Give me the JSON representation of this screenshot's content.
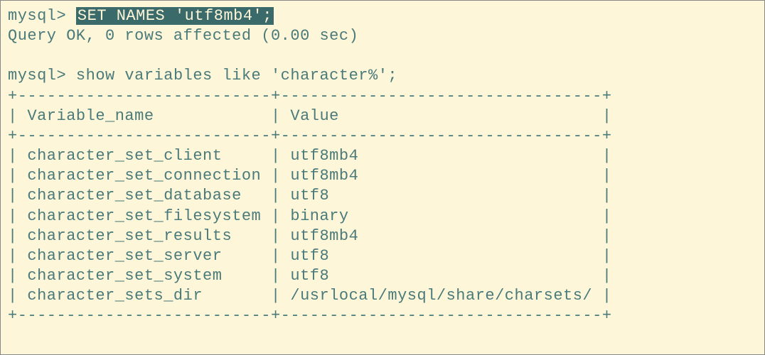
{
  "prompt": "mysql>",
  "commands": {
    "set_names": "SET NAMES 'utf8mb4';",
    "response": "Query OK, 0 rows affected (0.00 sec)",
    "show_vars": "show variables like 'character%';"
  },
  "table": {
    "col1_header": "Variable_name",
    "col2_header": "Value",
    "col1_width": 26,
    "col2_width": 33,
    "rows": [
      {
        "name": "character_set_client",
        "value": "utf8mb4"
      },
      {
        "name": "character_set_connection",
        "value": "utf8mb4"
      },
      {
        "name": "character_set_database",
        "value": "utf8"
      },
      {
        "name": "character_set_filesystem",
        "value": "binary"
      },
      {
        "name": "character_set_results",
        "value": "utf8mb4"
      },
      {
        "name": "character_set_server",
        "value": "utf8"
      },
      {
        "name": "character_set_system",
        "value": "utf8"
      },
      {
        "name": "character_sets_dir",
        "value": "/usrlocal/mysql/share/charsets/"
      }
    ]
  }
}
